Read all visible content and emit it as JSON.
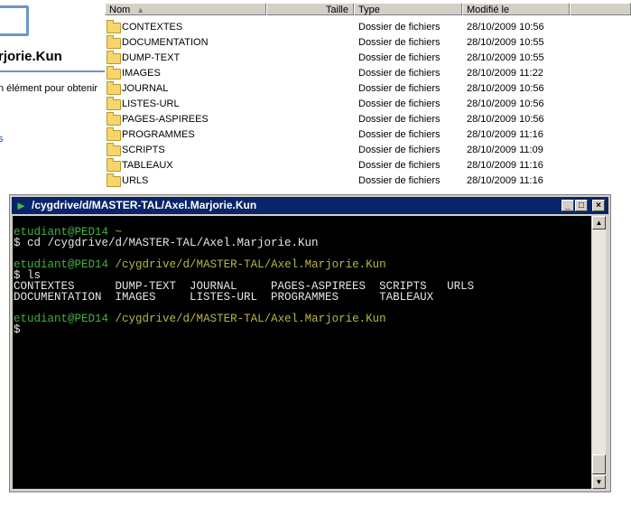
{
  "left_panel": {
    "folder_title": "rjorie.Kun",
    "description": "n élément pour obtenir",
    "link": "s"
  },
  "file_list": {
    "columns": {
      "name": "Nom",
      "size": "Taille",
      "type": "Type",
      "modified": "Modifié le"
    },
    "sort_icon": "sort-ascending-icon",
    "rows": [
      {
        "name": "CONTEXTES",
        "type": "Dossier de fichiers",
        "modified": "28/10/2009 10:56"
      },
      {
        "name": "DOCUMENTATION",
        "type": "Dossier de fichiers",
        "modified": "28/10/2009 10:55"
      },
      {
        "name": "DUMP-TEXT",
        "type": "Dossier de fichiers",
        "modified": "28/10/2009 10:55"
      },
      {
        "name": "IMAGES",
        "type": "Dossier de fichiers",
        "modified": "28/10/2009 11:22"
      },
      {
        "name": "JOURNAL",
        "type": "Dossier de fichiers",
        "modified": "28/10/2009 10:56"
      },
      {
        "name": "LISTES-URL",
        "type": "Dossier de fichiers",
        "modified": "28/10/2009 10:56"
      },
      {
        "name": "PAGES-ASPIREES",
        "type": "Dossier de fichiers",
        "modified": "28/10/2009 10:56"
      },
      {
        "name": "PROGRAMMES",
        "type": "Dossier de fichiers",
        "modified": "28/10/2009 11:16"
      },
      {
        "name": "SCRIPTS",
        "type": "Dossier de fichiers",
        "modified": "28/10/2009 11:09"
      },
      {
        "name": "TABLEAUX",
        "type": "Dossier de fichiers",
        "modified": "28/10/2009 11:16"
      },
      {
        "name": "URLS",
        "type": "Dossier de fichiers",
        "modified": "28/10/2009 11:16"
      }
    ]
  },
  "terminal": {
    "title": "/cygdrive/d/MASTER-TAL/Axel.Marjorie.Kun",
    "buttons": {
      "minimize": "_",
      "maximize": "□",
      "close": "×"
    },
    "lines": [
      {
        "user": "etudiant@PED14",
        "path": "~"
      },
      {
        "text": "$ cd /cygdrive/d/MASTER-TAL/Axel.Marjorie.Kun"
      },
      {
        "text": ""
      },
      {
        "user": "etudiant@PED14",
        "path": "/cygdrive/d/MASTER-TAL/Axel.Marjorie.Kun"
      },
      {
        "text": "$ ls"
      },
      {
        "text": "CONTEXTES      DUMP-TEXT  JOURNAL     PAGES-ASPIREES  SCRIPTS   URLS"
      },
      {
        "text": "DOCUMENTATION  IMAGES     LISTES-URL  PROGRAMMES      TABLEAUX"
      },
      {
        "text": ""
      },
      {
        "user": "etudiant@PED14",
        "path": "/cygdrive/d/MASTER-TAL/Axel.Marjorie.Kun"
      },
      {
        "text": "$"
      }
    ]
  },
  "colors": {
    "titlebar": "#0a246a",
    "prompt_user": "#3fb33f",
    "prompt_path": "#b8b843",
    "console_bg": "#000000",
    "console_text": "#e6e6e6"
  }
}
